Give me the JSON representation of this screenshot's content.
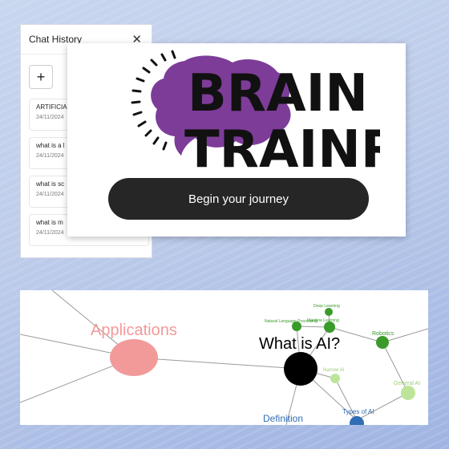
{
  "history": {
    "title": "Chat History",
    "close_icon": "close-icon",
    "new_label": "+",
    "items": [
      {
        "title": "ARTIFICIAL",
        "date": "24/11/2024"
      },
      {
        "title": "what is a l",
        "date": "24/11/2024"
      },
      {
        "title": "what is sc",
        "date": "24/11/2024"
      },
      {
        "title": "what is m",
        "date": "24/11/2024"
      }
    ]
  },
  "welcome": {
    "logo_line1": "BRAIN",
    "logo_line2": "TRAINR",
    "button_label": "Begin your journey"
  },
  "mindmap": {
    "nodes": {
      "applications": "Applications",
      "what_is_ai": "What is AI?",
      "definition": "Definition",
      "deep_learning": "Deep Learning",
      "machine_learning": "Machine Learning",
      "nlp": "Natural Language Processing",
      "robotics": "Robotics",
      "narrow_ai": "Narrow AI",
      "general_ai": "General AI",
      "types_of_ai": "Types of AI"
    },
    "colors": {
      "applications": "#f29a9a",
      "center": "#000000",
      "green": "#3a9a2a",
      "light_green": "#bde59a",
      "blue": "#2f6db5"
    }
  }
}
